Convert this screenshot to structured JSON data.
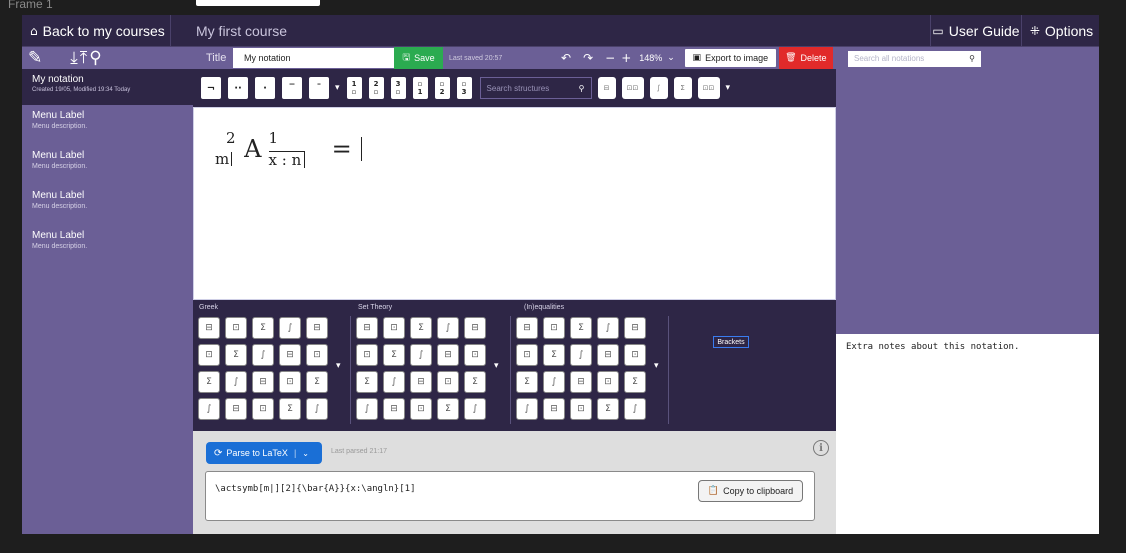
{
  "frame_label": "Frame 1",
  "topbar": {
    "back_label": "Back to my courses",
    "course_name": "My first course",
    "user_guide_label": "User Guide",
    "options_label": "Options"
  },
  "sidebar": {
    "active_notation": {
      "name": "My notation",
      "meta": "Created 19/05, Modified 19:34 Today"
    },
    "items": [
      {
        "label": "Menu Label",
        "description": "Menu description."
      },
      {
        "label": "Menu Label",
        "description": "Menu description."
      },
      {
        "label": "Menu Label",
        "description": "Menu description."
      },
      {
        "label": "Menu Label",
        "description": "Menu description."
      }
    ]
  },
  "title_bar": {
    "title_label": "Title",
    "title_value": "My notation",
    "save_label": "Save",
    "last_saved": "Last saved 20:57",
    "zoom": "148%",
    "export_label": "Export to image",
    "delete_label": "Delete"
  },
  "search_notations_placeholder": "Search all notations",
  "struct_toolbar": {
    "search_placeholder": "Search structures",
    "position_labels": [
      "1",
      "2",
      "3",
      "1",
      "2",
      "3"
    ]
  },
  "editor": {
    "pre_super": "2",
    "pre_sub": "m",
    "base": "A",
    "super": "1",
    "sub": "x : n",
    "op": "="
  },
  "palettes": {
    "greek_title": "Greek",
    "set_theory_title": "Set Theory",
    "inequalities_title": "(In)equalities",
    "brackets_label": "Brackets"
  },
  "notes": {
    "text": "Extra notes about this notation."
  },
  "latex": {
    "parse_label": "Parse to LaTeX",
    "last_parsed": "Last parsed 21:17",
    "code": "\\actsymb[m|][2]{\\bar{A}}{x:\\angln}[1]",
    "copy_label": "Copy to clipboard"
  },
  "colors": {
    "accent": "#6b5f96",
    "dark": "#2e2646",
    "save": "#2bab50",
    "delete": "#e12a2a",
    "parse": "#1a6fd6"
  }
}
